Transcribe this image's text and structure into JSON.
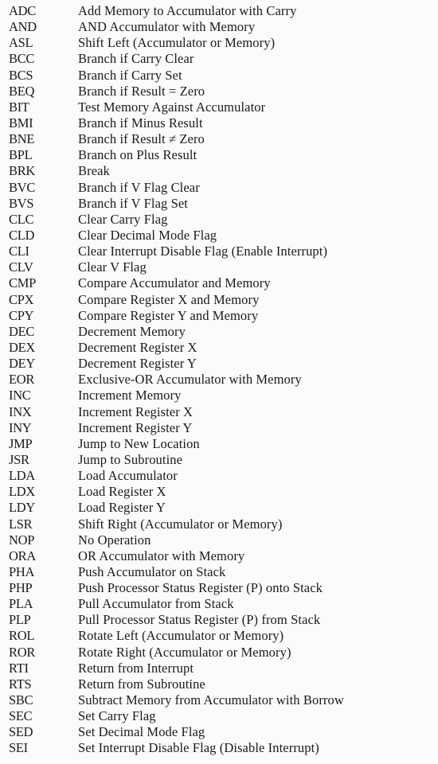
{
  "instructions": [
    [
      "ADC",
      "Add Memory to Accumulator with Carry"
    ],
    [
      "AND",
      "AND Accumulator with Memory"
    ],
    [
      "ASL",
      "Shift Left (Accumulator or Memory)"
    ],
    [
      "BCC",
      "Branch if Carry Clear"
    ],
    [
      "BCS",
      "Branch if Carry Set"
    ],
    [
      "BEQ",
      "Branch if Result = Zero"
    ],
    [
      "BIT",
      "Test Memory Against Accumulator"
    ],
    [
      "BMI",
      "Branch if Minus Result"
    ],
    [
      "BNE",
      "Branch if Result ≠ Zero"
    ],
    [
      "BPL",
      "Branch on Plus Result"
    ],
    [
      "BRK",
      "Break"
    ],
    [
      "BVC",
      "Branch if V Flag Clear"
    ],
    [
      "BVS",
      "Branch if V Flag Set"
    ],
    [
      "CLC",
      "Clear Carry Flag"
    ],
    [
      "CLD",
      "Clear Decimal Mode Flag"
    ],
    [
      "CLI",
      "Clear Interrupt Disable Flag (Enable Interrupt)"
    ],
    [
      "CLV",
      "Clear V Flag"
    ],
    [
      "CMP",
      "Compare Accumulator and Memory"
    ],
    [
      "CPX",
      "Compare Register X and Memory"
    ],
    [
      "CPY",
      "Compare Register Y and Memory"
    ],
    [
      "DEC",
      "Decrement Memory"
    ],
    [
      "DEX",
      "Decrement Register X"
    ],
    [
      "DEY",
      "Decrement Register Y"
    ],
    [
      "EOR",
      "Exclusive-OR Accumulator with Memory"
    ],
    [
      "INC",
      "Increment Memory"
    ],
    [
      "INX",
      "Increment Register X"
    ],
    [
      "INY",
      "Increment Register Y"
    ],
    [
      "JMP",
      "Jump to New Location"
    ],
    [
      "JSR",
      "Jump to Subroutine"
    ],
    [
      "LDA",
      "Load Accumulator"
    ],
    [
      "LDX",
      "Load Register X"
    ],
    [
      "LDY",
      "Load Register Y"
    ],
    [
      "LSR",
      "Shift Right (Accumulator or Memory)"
    ],
    [
      "NOP",
      "No Operation"
    ],
    [
      "ORA",
      "OR Accumulator with Memory"
    ],
    [
      "PHA",
      "Push Accumulator on Stack"
    ],
    [
      "PHP",
      "Push Processor Status Register (P) onto Stack"
    ],
    [
      "PLA",
      "Pull Accumulator from Stack"
    ],
    [
      "PLP",
      "Pull Processor Status Register (P) from Stack"
    ],
    [
      "ROL",
      "Rotate Left (Accumulator or Memory)"
    ],
    [
      "ROR",
      "Rotate Right (Accumulator or Memory)"
    ],
    [
      "RTI",
      "Return from Interrupt"
    ],
    [
      "RTS",
      "Return from Subroutine"
    ],
    [
      "SBC",
      "Subtract Memory from Accumulator with Borrow"
    ],
    [
      "SEC",
      "Set Carry Flag"
    ],
    [
      "SED",
      "Set Decimal Mode Flag"
    ],
    [
      "SEI",
      "Set Interrupt Disable Flag (Disable Interrupt)"
    ]
  ]
}
